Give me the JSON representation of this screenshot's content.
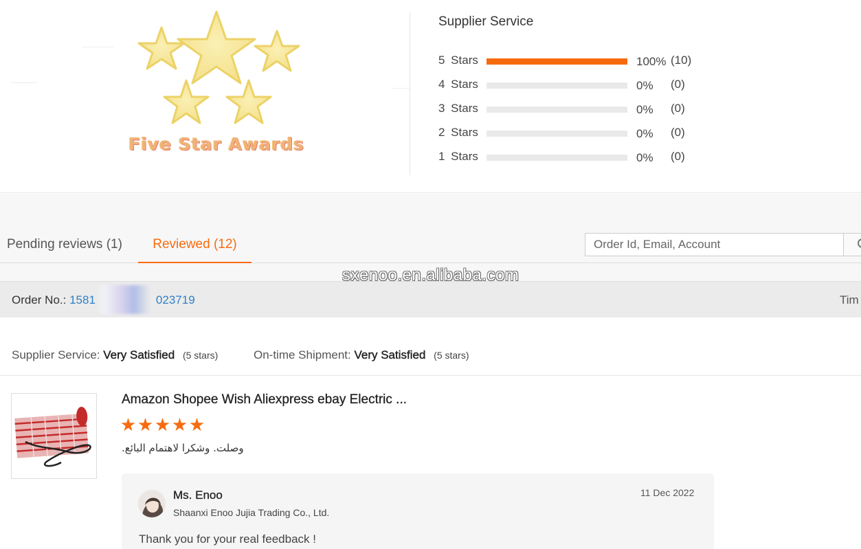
{
  "badge": {
    "text": "Five Star Awards"
  },
  "supplier_service": {
    "title": "Supplier Service",
    "ratings": [
      {
        "label": "5 Stars",
        "fraction": 1.0,
        "percent": "100%",
        "count": "(10)"
      },
      {
        "label": "4 Stars",
        "fraction": 0.0,
        "percent": "0%",
        "count": "(0)"
      },
      {
        "label": "3 Stars",
        "fraction": 0.0,
        "percent": "0%",
        "count": "(0)"
      },
      {
        "label": "2 Stars",
        "fraction": 0.0,
        "percent": "0%",
        "count": "(0)"
      },
      {
        "label": "1 Stars",
        "fraction": 0.0,
        "percent": "0%",
        "count": "(0)"
      }
    ],
    "bar_color": "#f76b0f"
  },
  "tabs": {
    "pending": "Pending reviews (1)",
    "reviewed": "Reviewed (12)"
  },
  "search": {
    "placeholder": "Order Id, Email, Account"
  },
  "watermark": "sxenoo.en.alibaba.com",
  "order": {
    "label": "Order No.:",
    "id_prefix": "1581",
    "id_suffix": "023719",
    "time_label": "Tim"
  },
  "summary": {
    "supplier_label": "Supplier Service:",
    "supplier_value": "Very Satisfied",
    "supplier_stars": "(5 stars)",
    "shipment_label": "On-time Shipment:",
    "shipment_value": "Very Satisfied",
    "shipment_stars": "(5 stars)"
  },
  "review": {
    "product_title": "Amazon Shopee Wish Aliexpress ebay Electric ...",
    "star_count": 5,
    "text": "وصلت. وشكرا لاهتمام البائع."
  },
  "reply": {
    "name": "Ms. Enoo",
    "company": "Shaanxi Enoo Jujia Trading Co., Ltd.",
    "date": "11 Dec 2022",
    "text": "Thank you for your real feedback !"
  },
  "accent_color": "#f76b0f",
  "link_color": "#2f80c6"
}
